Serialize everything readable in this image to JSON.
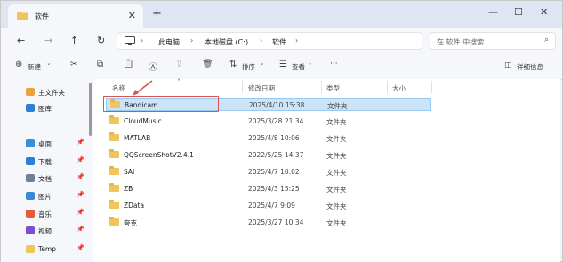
{
  "tab": {
    "title": "软件"
  },
  "window": {
    "minimize": "—",
    "maximize": "☐",
    "close": "✕"
  },
  "address": {
    "crumbs": [
      "此电脑",
      "本地磁盘 (C:)",
      "软件"
    ],
    "search_placeholder": "在 软件 中搜索"
  },
  "toolbar": {
    "new_label": "新建",
    "sort_label": "排序",
    "view_label": "查看",
    "more_label": "···",
    "details_label": "详细信息"
  },
  "sidebar": {
    "items": [
      {
        "label": "主文件夹",
        "icon": "home-icon",
        "color": "#e8a33c",
        "pinned": false
      },
      {
        "label": "图库",
        "icon": "gallery-icon",
        "color": "#2f7fd6",
        "pinned": false
      },
      {
        "label": "桌面",
        "icon": "desktop-icon",
        "color": "#3b8fd9",
        "pinned": true
      },
      {
        "label": "下载",
        "icon": "download-icon",
        "color": "#2a7dd8",
        "pinned": true
      },
      {
        "label": "文档",
        "icon": "document-icon",
        "color": "#6f7f96",
        "pinned": true
      },
      {
        "label": "图片",
        "icon": "pictures-icon",
        "color": "#3a87d6",
        "pinned": true
      },
      {
        "label": "音乐",
        "icon": "music-icon",
        "color": "#e55b3c",
        "pinned": true
      },
      {
        "label": "视频",
        "icon": "video-icon",
        "color": "#7a4fd1",
        "pinned": true
      },
      {
        "label": "Temp",
        "icon": "folder-icon",
        "color": "#f2c55c",
        "pinned": true
      }
    ]
  },
  "columns": {
    "name": "名称",
    "date": "修改日期",
    "type": "类型",
    "size": "大小"
  },
  "files": [
    {
      "name": "Bandicam",
      "date": "2025/4/10 15:38",
      "type": "文件夹",
      "selected": true
    },
    {
      "name": "CloudMusic",
      "date": "2025/3/28 21:34",
      "type": "文件夹",
      "selected": false
    },
    {
      "name": "MATLAB",
      "date": "2025/4/8 10:06",
      "type": "文件夹",
      "selected": false
    },
    {
      "name": "QQScreenShotV2.4.1",
      "date": "2022/5/25 14:37",
      "type": "文件夹",
      "selected": false
    },
    {
      "name": "SAI",
      "date": "2025/4/7 10:02",
      "type": "文件夹",
      "selected": false
    },
    {
      "name": "ZB",
      "date": "2025/4/3 15:25",
      "type": "文件夹",
      "selected": false
    },
    {
      "name": "ZData",
      "date": "2025/4/7 9:09",
      "type": "文件夹",
      "selected": false
    },
    {
      "name": "夸克",
      "date": "2025/3/27 10:34",
      "type": "文件夹",
      "selected": false
    }
  ],
  "annotation": {
    "color": "#d9534f"
  }
}
